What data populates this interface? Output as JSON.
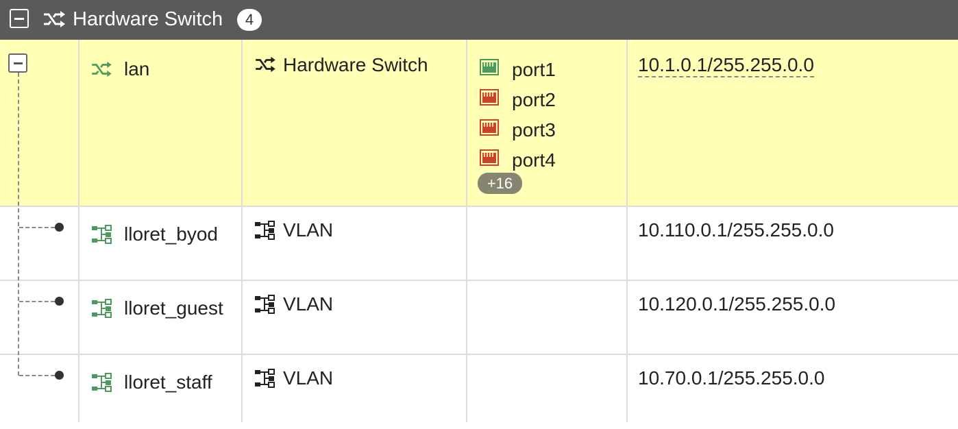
{
  "group": {
    "title": "Hardware Switch",
    "count": "4"
  },
  "rows": [
    {
      "name": "lan",
      "type": "Hardware Switch",
      "members": [
        "port1",
        "port2",
        "port3",
        "port4"
      ],
      "more_members": "+16",
      "ip": "10.1.0.1/255.255.0.0"
    },
    {
      "name": "lloret_byod",
      "type": "VLAN",
      "ip": "10.110.0.1/255.255.0.0"
    },
    {
      "name": "lloret_guest",
      "type": "VLAN",
      "ip": "10.120.0.1/255.255.0.0"
    },
    {
      "name": "lloret_staff",
      "type": "VLAN",
      "ip": "10.70.0.1/255.255.0.0"
    }
  ],
  "colors": {
    "header_bg": "#5a5a5a",
    "selected_row_bg": "#ffffb5",
    "port_up": "#4e9a5e",
    "port_down": "#c8442c",
    "interface_icon": "#4e9a5e"
  },
  "icons": {
    "group": "shuffle-icon",
    "lan": "shuffle-icon",
    "vlan": "vlan-icon",
    "port": "ethernet-port-icon"
  }
}
